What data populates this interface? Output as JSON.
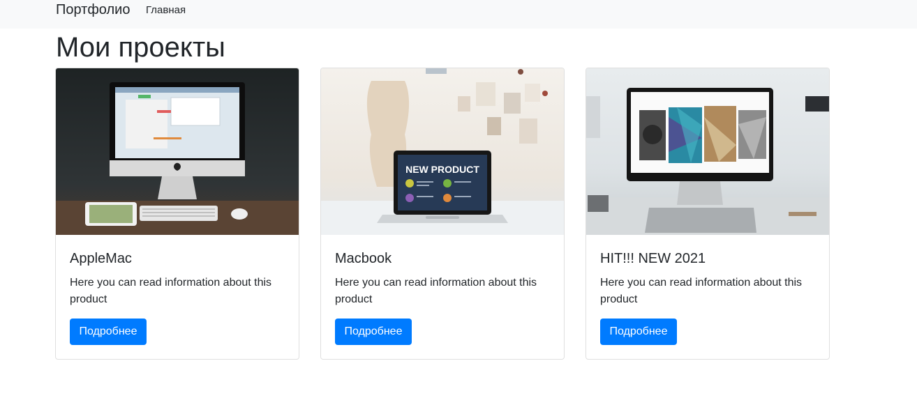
{
  "navbar": {
    "brand": "Портфолио",
    "links": [
      {
        "label": "Главная"
      }
    ]
  },
  "main": {
    "title": "Мои проекты",
    "cards": [
      {
        "title": "AppleMac",
        "text": "Here you can read information about this product",
        "button_label": "Подробнее",
        "image_screen_text": ""
      },
      {
        "title": "Macbook",
        "text": "Here you can read information about this product",
        "button_label": "Подробнее",
        "image_screen_text": "NEW PRODUCT"
      },
      {
        "title": "HIT!!! NEW 2021",
        "text": "Here you can read information about this product",
        "button_label": "Подробнее",
        "image_screen_text": ""
      }
    ]
  },
  "colors": {
    "navbar_bg": "#f8f9fa",
    "primary": "#007bff",
    "text": "#212529",
    "card_border": "#dfdfdf"
  }
}
